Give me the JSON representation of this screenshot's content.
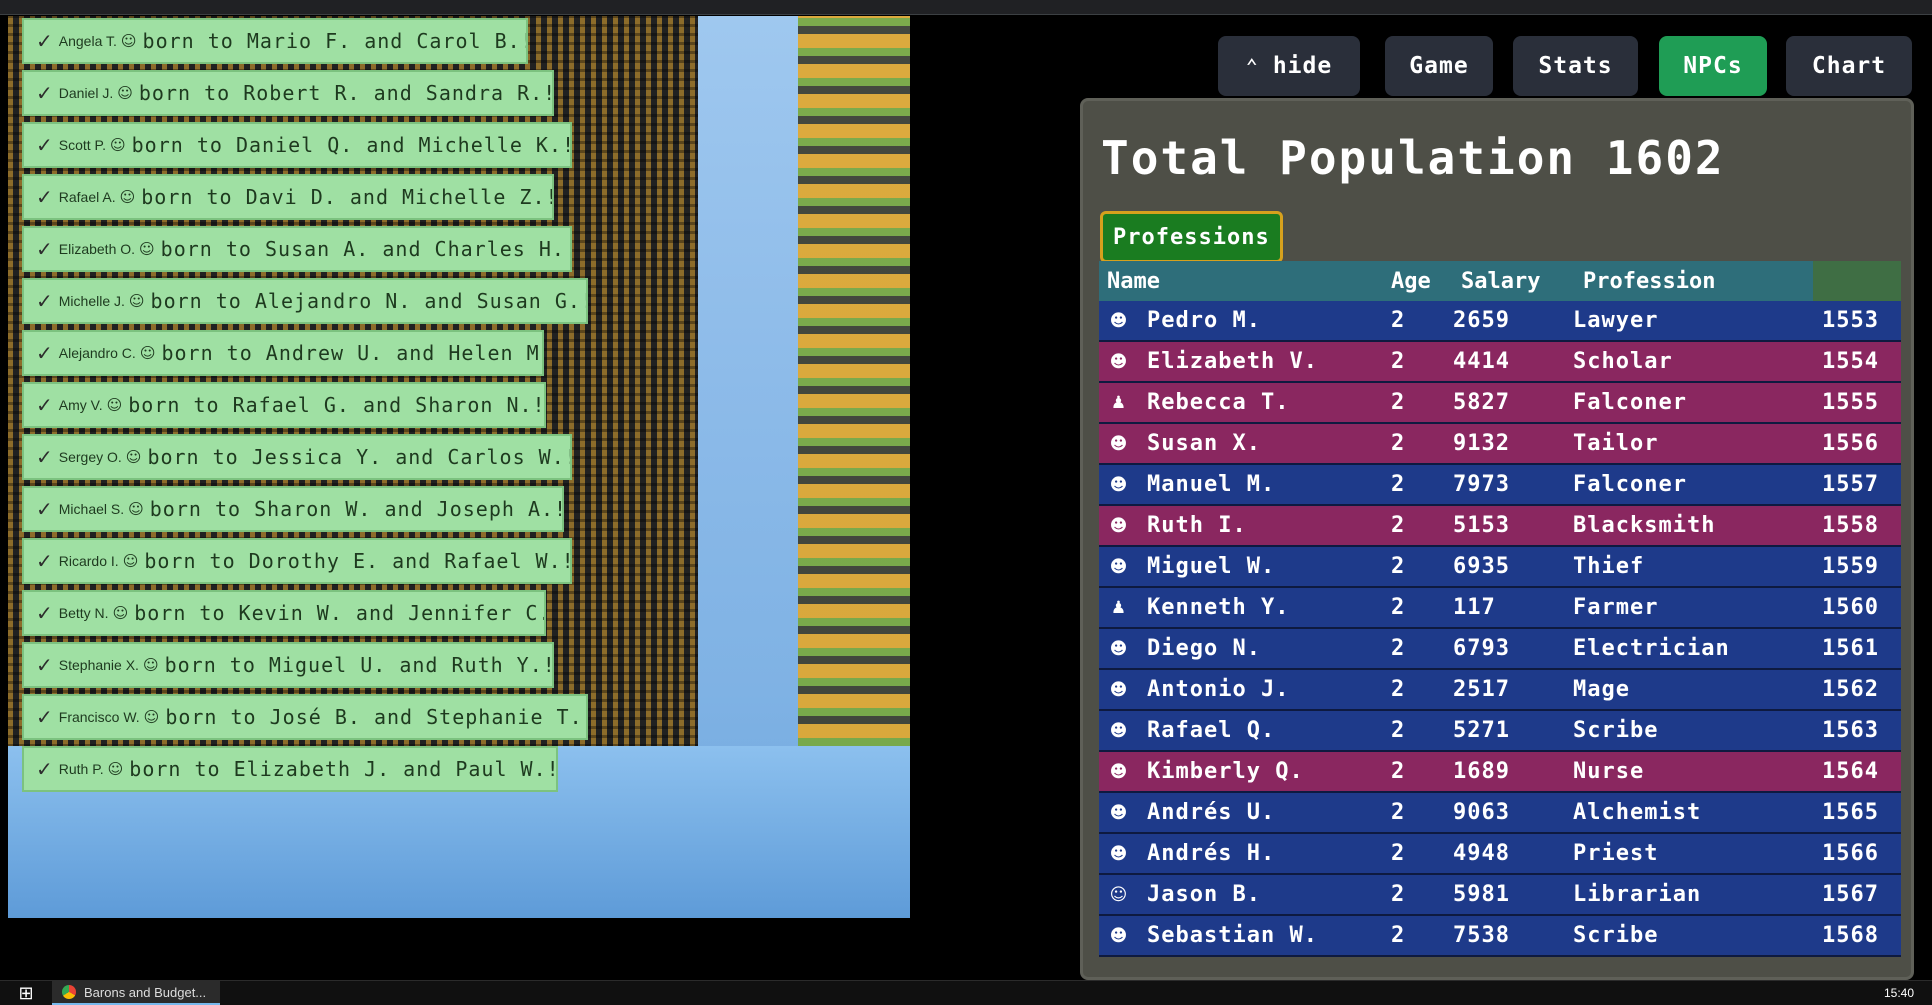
{
  "notifications": [
    {
      "name": "Angela T.",
      "message": "born to Mario F. and Carol B.!"
    },
    {
      "name": "Daniel J.",
      "message": "born to Robert R. and Sandra R.!"
    },
    {
      "name": "Scott P.",
      "message": "born to Daniel Q. and Michelle K.!"
    },
    {
      "name": "Rafael A.",
      "message": "born to Davi D. and Michelle Z.!"
    },
    {
      "name": "Elizabeth O.",
      "message": "born to Susan A. and Charles H.!"
    },
    {
      "name": "Michelle J.",
      "message": "born to Alejandro N. and Susan G.!"
    },
    {
      "name": "Alejandro C.",
      "message": "born to Andrew U. and Helen M.!"
    },
    {
      "name": "Amy V.",
      "message": "born to Rafael G. and Sharon N.!"
    },
    {
      "name": "Sergey O.",
      "message": "born to Jessica Y. and Carlos W.!"
    },
    {
      "name": "Michael S.",
      "message": "born to Sharon W. and Joseph A.!"
    },
    {
      "name": "Ricardo I.",
      "message": "born to Dorothy E. and Rafael W.!"
    },
    {
      "name": "Betty N.",
      "message": "born to Kevin W. and Jennifer C.!"
    },
    {
      "name": "Stephanie X.",
      "message": "born to Miguel U. and Ruth Y.!"
    },
    {
      "name": "Francisco W.",
      "message": "born to José B. and Stephanie T.!"
    },
    {
      "name": "Ruth P.",
      "message": "born to Elizabeth J. and Paul W.!"
    }
  ],
  "notification_icons": {
    "check": "✓",
    "baby": "☺",
    "bottle": "▯",
    "close": "×"
  },
  "buttons": {
    "hide": "hide",
    "game": "Game",
    "stats": "Stats",
    "npcs": "NPCs",
    "chart": "Chart"
  },
  "panel": {
    "title": "Total Population 1602",
    "professions_button": "Professions",
    "columns": {
      "name": "Name",
      "age": "Age",
      "salary": "Salary",
      "profession": "Profession"
    },
    "rows": [
      {
        "icon": "☻",
        "name": "Pedro M.",
        "age": "2",
        "salary": "2659",
        "profession": "Lawyer",
        "id": "1553",
        "color": "blue"
      },
      {
        "icon": "☻",
        "name": "Elizabeth V.",
        "age": "2",
        "salary": "4414",
        "profession": "Scholar",
        "id": "1554",
        "color": "red"
      },
      {
        "icon": "♟",
        "name": "Rebecca T.",
        "age": "2",
        "salary": "5827",
        "profession": "Falconer",
        "id": "1555",
        "color": "red"
      },
      {
        "icon": "☻",
        "name": "Susan X.",
        "age": "2",
        "salary": "9132",
        "profession": "Tailor",
        "id": "1556",
        "color": "red"
      },
      {
        "icon": "☻",
        "name": "Manuel M.",
        "age": "2",
        "salary": "7973",
        "profession": "Falconer",
        "id": "1557",
        "color": "blue"
      },
      {
        "icon": "☻",
        "name": "Ruth I.",
        "age": "2",
        "salary": "5153",
        "profession": "Blacksmith",
        "id": "1558",
        "color": "red"
      },
      {
        "icon": "☻",
        "name": "Miguel W.",
        "age": "2",
        "salary": "6935",
        "profession": "Thief",
        "id": "1559",
        "color": "blue"
      },
      {
        "icon": "♟",
        "name": "Kenneth Y.",
        "age": "2",
        "salary": "117",
        "profession": "Farmer",
        "id": "1560",
        "color": "blue"
      },
      {
        "icon": "☻",
        "name": "Diego N.",
        "age": "2",
        "salary": "6793",
        "profession": "Electrician",
        "id": "1561",
        "color": "blue"
      },
      {
        "icon": "☻",
        "name": "Antonio J.",
        "age": "2",
        "salary": "2517",
        "profession": "Mage",
        "id": "1562",
        "color": "blue"
      },
      {
        "icon": "☻",
        "name": "Rafael Q.",
        "age": "2",
        "salary": "5271",
        "profession": "Scribe",
        "id": "1563",
        "color": "blue"
      },
      {
        "icon": "☻",
        "name": "Kimberly Q.",
        "age": "2",
        "salary": "1689",
        "profession": "Nurse",
        "id": "1564",
        "color": "red"
      },
      {
        "icon": "☻",
        "name": "Andrés U.",
        "age": "2",
        "salary": "9063",
        "profession": "Alchemist",
        "id": "1565",
        "color": "blue"
      },
      {
        "icon": "☻",
        "name": "Andrés H.",
        "age": "2",
        "salary": "4948",
        "profession": "Priest",
        "id": "1566",
        "color": "blue"
      },
      {
        "icon": "☺",
        "name": "Jason B.",
        "age": "2",
        "salary": "5981",
        "profession": "Librarian",
        "id": "1567",
        "color": "blue"
      },
      {
        "icon": "☻",
        "name": "Sebastian W.",
        "age": "2",
        "salary": "7538",
        "profession": "Scribe",
        "id": "1568",
        "color": "blue"
      }
    ]
  },
  "taskbar": {
    "window_title": "Barons and Budget...",
    "clock": "15:40"
  },
  "colors": {
    "row_blue": "#1e3a8a",
    "row_red": "#8a2760",
    "active_button": "#1f9d55",
    "toast_bg": "#9fe0a3"
  }
}
